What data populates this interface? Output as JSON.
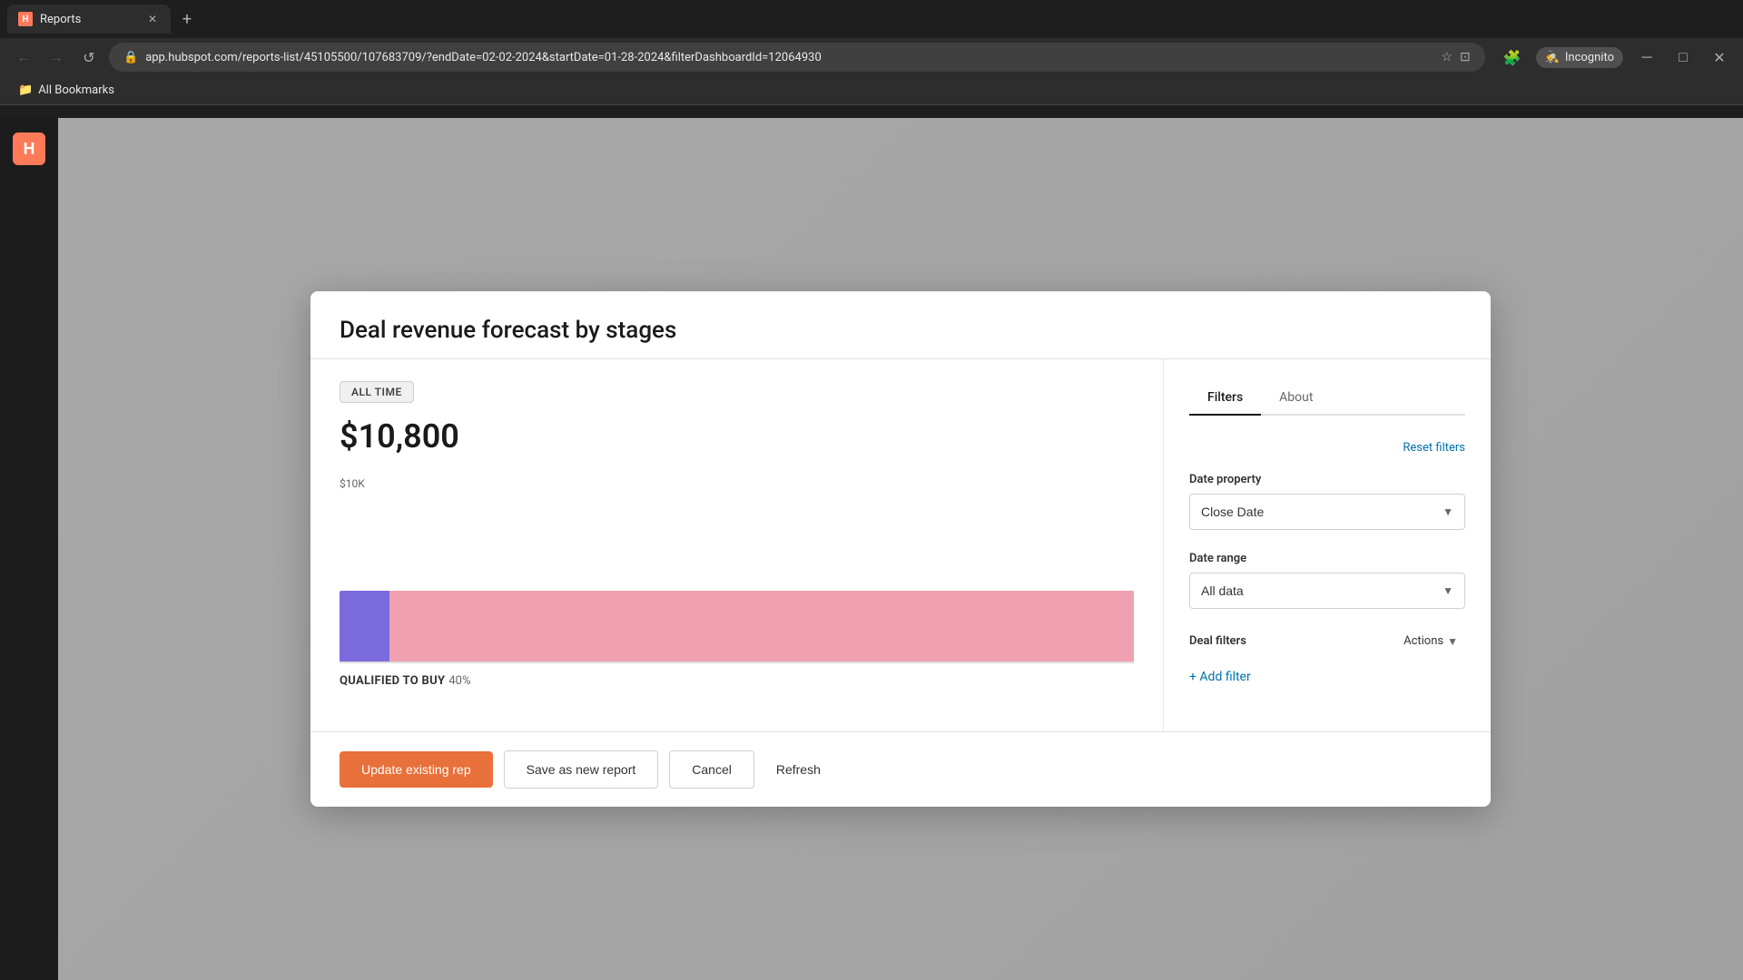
{
  "browser": {
    "tab_title": "Reports",
    "tab_favicon": "H",
    "url": "app.hubspot.com/reports-list/45105500/107683709/?endDate=02-02-2024&startDate=01-28-2024&filterDashboardId=12064930",
    "new_tab_icon": "+",
    "nav_back": "←",
    "nav_forward": "→",
    "nav_refresh": "↺",
    "incognito_label": "Incognito",
    "bookmarks_label": "All Bookmarks"
  },
  "modal": {
    "title": "Deal revenue forecast by stages",
    "time_badge": "ALL TIME",
    "chart_value": "$10,800",
    "chart_y_label": "$10K",
    "legend_label": "QUALIFIED TO BUY",
    "legend_pct": "40%",
    "filters_tab": "Filters",
    "about_tab": "About",
    "reset_filters_label": "Reset filters",
    "date_property_label": "Date property",
    "date_property_value": "Close Date",
    "date_range_label": "Date range",
    "date_range_value": "All data",
    "deal_filters_label": "Deal filters",
    "actions_label": "Actions",
    "add_filter_label": "+ Add filter",
    "chevron_symbol": "▼"
  },
  "footer": {
    "update_existing_label": "Update existing rep",
    "save_new_label": "Save as new report",
    "cancel_label": "Cancel",
    "refresh_label": "Refresh"
  },
  "colors": {
    "bar_purple": "#7c6bde",
    "bar_pink": "#f0a0b0",
    "btn_primary": "#e8703a",
    "link_blue": "#0073aa"
  }
}
